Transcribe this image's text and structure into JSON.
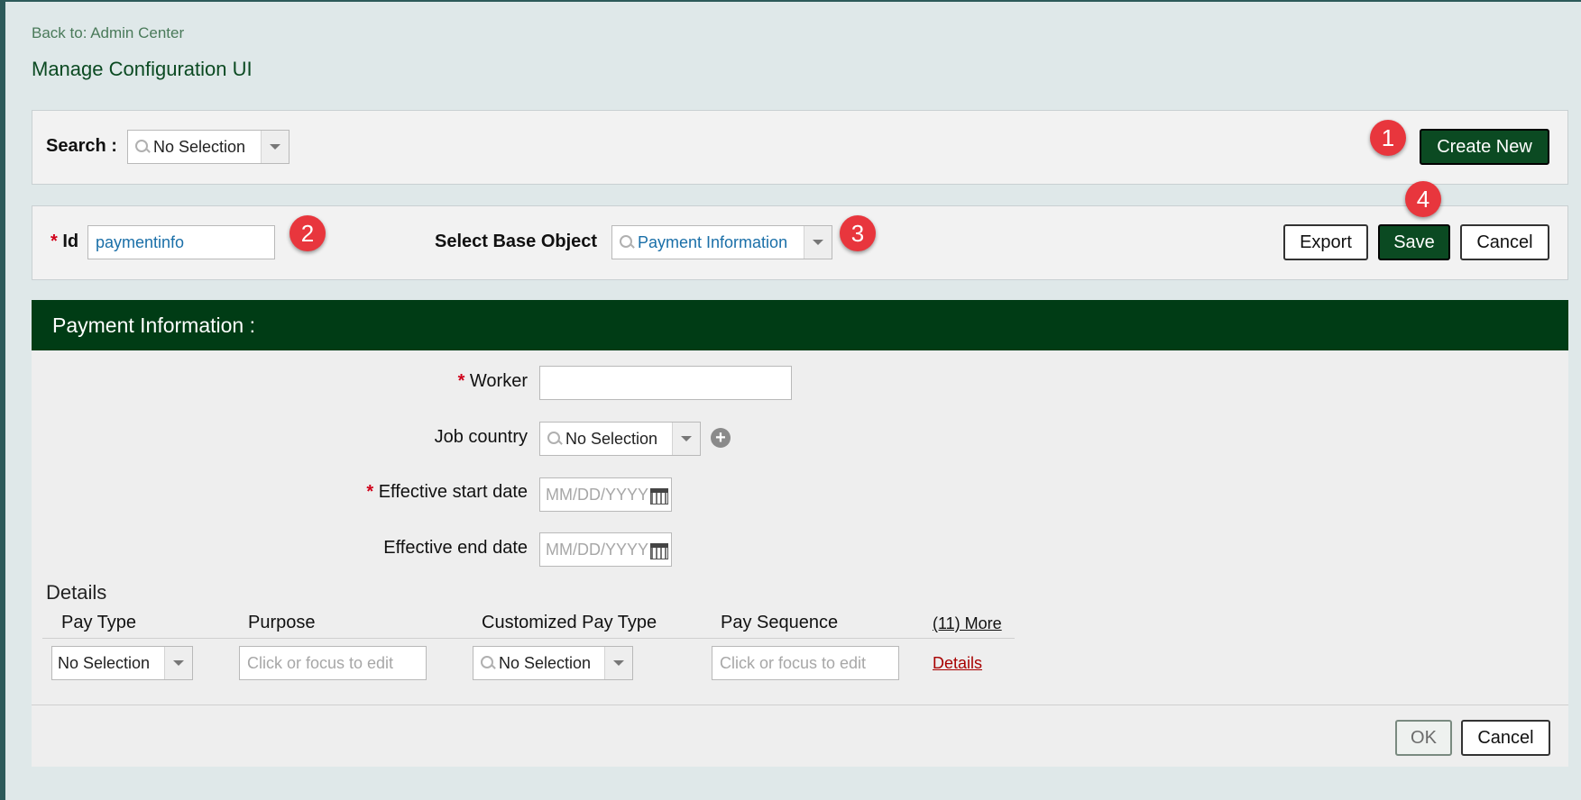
{
  "nav": {
    "back_link": "Back to: Admin Center"
  },
  "page_title": "Manage Configuration UI",
  "search_bar": {
    "label": "Search :",
    "value": "No Selection",
    "create_button": "Create New"
  },
  "config_bar": {
    "id_label": "Id",
    "id_value": "paymentinfo",
    "base_object_label": "Select Base Object",
    "base_object_value": "Payment Information",
    "export_button": "Export",
    "save_button": "Save",
    "cancel_button": "Cancel"
  },
  "annotations": [
    "1",
    "2",
    "3",
    "4"
  ],
  "form": {
    "section_title": "Payment Information :",
    "worker_label": "Worker",
    "worker_value": "",
    "job_country_label": "Job country",
    "job_country_value": "No Selection",
    "start_date_label": "Effective start date",
    "start_date_placeholder": "MM/DD/YYYY",
    "end_date_label": "Effective end date",
    "end_date_placeholder": "MM/DD/YYYY"
  },
  "details": {
    "title": "Details",
    "columns": [
      "Pay Type",
      "Purpose",
      "Customized Pay Type",
      "Pay Sequence"
    ],
    "more_link": "(11) More",
    "row": {
      "pay_type": "No Selection",
      "purpose_placeholder": "Click or focus to edit",
      "customized_pay_type": "No Selection",
      "pay_sequence_placeholder": "Click or focus to edit",
      "details_link": "Details"
    }
  },
  "footer": {
    "ok_button": "OK",
    "cancel_button": "Cancel"
  },
  "colors": {
    "brand_green": "#0b4a22",
    "header_green": "#003c15",
    "badge_red": "#e8363d",
    "link_red": "#a80000"
  }
}
